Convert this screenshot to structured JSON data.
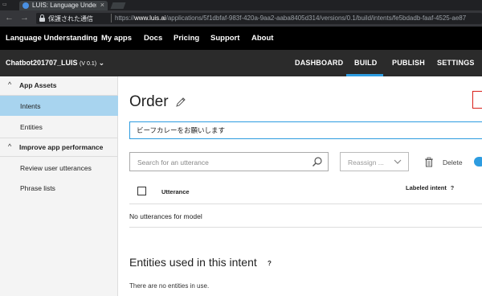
{
  "browser": {
    "tab_title": "LUIS: Language Understa...",
    "tab_close": "×",
    "back": "←",
    "forward": "→",
    "secure_label": "保護された通信",
    "url_scheme": "https://",
    "url_host": "www.luis.ai",
    "url_path": "/applications/5f1dbfaf-983f-420a-9aa2-aaba8405d314/versions/0.1/build/intents/fe5bdadb-faaf-4525-ae87"
  },
  "app_nav": {
    "items": [
      "Language Understanding",
      "My apps",
      "Docs",
      "Pricing",
      "Support",
      "About"
    ]
  },
  "sub_nav": {
    "app_name": "Chatbot201707_LUIS",
    "version": "(V 0.1)",
    "dropdown_glyph": "⌄",
    "tabs": [
      "DASHBOARD",
      "BUILD",
      "PUBLISH",
      "SETTINGS"
    ],
    "active_tab": "BUILD"
  },
  "sidebar": {
    "sections": [
      {
        "label": "App Assets",
        "chevron": "^",
        "items": [
          "Intents",
          "Entities"
        ]
      },
      {
        "label": "Improve app performance",
        "chevron": "^",
        "items": [
          "Review user utterances",
          "Phrase lists"
        ]
      }
    ],
    "active_item": "Intents"
  },
  "main": {
    "title": "Order",
    "utterance_value": "ビーフカレーをお願いします",
    "search_placeholder": "Search for an utterance",
    "reassign_label": "Reassign ...",
    "delete_label": "Delete",
    "table": {
      "col_utterance": "Utterance",
      "col_labeled": "Labeled intent",
      "help_glyph": "?",
      "empty_text": "No utterances for model"
    },
    "entities_heading": "Entities used in this intent",
    "entities_help": "?",
    "entities_empty": "There are no entities in use."
  },
  "colors": {
    "accent": "#2d9ce0",
    "active_sidebar": "#a8d4ef",
    "nav_bg": "#000000",
    "subnav_bg": "#2b2b2b"
  }
}
